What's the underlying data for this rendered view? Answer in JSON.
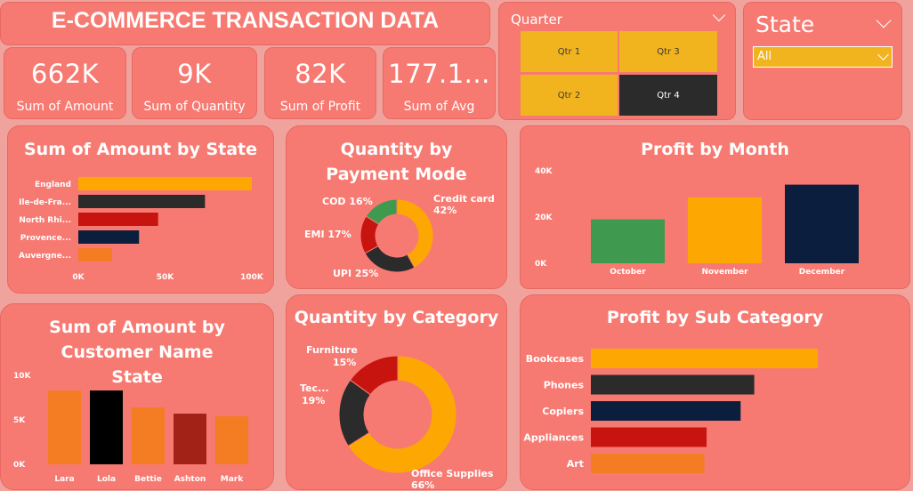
{
  "header": {
    "title": "E-COMMERCE TRANSACTION DATA"
  },
  "kpis": [
    {
      "value": "662K",
      "label": "Sum of Amount"
    },
    {
      "value": "9K",
      "label": "Sum of Quantity"
    },
    {
      "value": "82K",
      "label": "Sum of Profit"
    },
    {
      "value": "177.1...",
      "label": "Sum of Avg"
    }
  ],
  "quarter_slicer": {
    "title": "Quarter",
    "options": [
      {
        "label": "Qtr 1",
        "selected": false
      },
      {
        "label": "Qtr 3",
        "selected": false
      },
      {
        "label": "Qtr 2",
        "selected": false
      },
      {
        "label": "Qtr 4",
        "selected": true
      }
    ]
  },
  "state_slicer": {
    "title": "State",
    "selected": "All"
  },
  "colors": {
    "card": "#f77a72",
    "orange": "#fda802",
    "dark": "#2b2b2b",
    "red": "#c8140f",
    "navy": "#0c1e3d",
    "light_orange": "#f47c22",
    "green": "#3f9a4f",
    "black": "#000000",
    "maroon": "#a32218",
    "slicer_yellow": "#f2b41e"
  },
  "chart_data": [
    {
      "id": "amount_by_state",
      "type": "bar",
      "orientation": "horizontal",
      "title": "Sum of Amount by State",
      "categories": [
        "England",
        "Ile-de-Fra...",
        "North Rhi...",
        "Provence...",
        "Auvergne..."
      ],
      "values": [
        100000,
        73000,
        46000,
        35000,
        19500
      ],
      "colors": [
        "#fda802",
        "#2b2b2b",
        "#c8140f",
        "#0c1e3d",
        "#f47c22"
      ],
      "xlim": [
        0,
        100000
      ],
      "ticks": [
        0,
        50000,
        100000
      ],
      "tick_labels": [
        "0K",
        "50K",
        "100K"
      ]
    },
    {
      "id": "quantity_by_payment_mode",
      "type": "pie",
      "donut": true,
      "title": "Quantity by Payment Mode",
      "categories": [
        "Credit card",
        "UPI",
        "EMI",
        "COD"
      ],
      "values": [
        42,
        25,
        17,
        16
      ],
      "labels": [
        "Credit card 42%",
        "UPI 25%",
        "EMI 17%",
        "COD 16%"
      ],
      "colors": [
        "#fda802",
        "#2b2b2b",
        "#c8140f",
        "#3f9a4f"
      ]
    },
    {
      "id": "profit_by_month",
      "type": "bar",
      "orientation": "vertical",
      "title": "Profit by Month",
      "categories": [
        "October",
        "November",
        "December"
      ],
      "values": [
        19000,
        28500,
        34000
      ],
      "colors": [
        "#3f9a4f",
        "#fda802",
        "#0c1e3d"
      ],
      "ylim": [
        0,
        40000
      ],
      "ticks": [
        0,
        20000,
        40000
      ],
      "tick_labels": [
        "0K",
        "20K",
        "40K"
      ]
    },
    {
      "id": "amount_by_customer",
      "type": "bar",
      "orientation": "vertical",
      "title": "Sum of Amount by Customer Name State",
      "categories": [
        "Lara",
        "Lola",
        "Bettie",
        "Ashton",
        "Mark"
      ],
      "values": [
        8300,
        8300,
        6400,
        5700,
        5400
      ],
      "colors": [
        "#f47c22",
        "#000000",
        "#f47c22",
        "#a32218",
        "#f47c22"
      ],
      "ylim": [
        0,
        10000
      ],
      "ticks": [
        0,
        5000,
        10000
      ],
      "tick_labels": [
        "0K",
        "5K",
        "10K"
      ]
    },
    {
      "id": "quantity_by_category",
      "type": "pie",
      "donut": true,
      "title": "Quantity by Category",
      "categories": [
        "Office Supplies",
        "Tec...",
        "Furniture"
      ],
      "values": [
        66,
        19,
        15
      ],
      "labels": [
        "Office Supplies",
        "66%",
        "Tec...",
        "19%",
        "Furniture",
        "15%"
      ],
      "colors": [
        "#fda802",
        "#2b2b2b",
        "#c8140f"
      ]
    },
    {
      "id": "profit_by_sub_category",
      "type": "bar",
      "orientation": "horizontal",
      "title": "Profit by Sub Category",
      "categories": [
        "Bookcases",
        "Phones",
        "Copiers",
        "Appliances",
        "Art"
      ],
      "values": [
        100,
        72,
        66,
        51,
        50
      ],
      "colors": [
        "#fda802",
        "#2b2b2b",
        "#0c1e3d",
        "#c8140f",
        "#f47c22"
      ]
    }
  ]
}
